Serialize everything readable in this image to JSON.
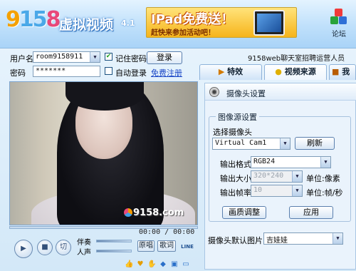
{
  "header": {
    "logo_digits": [
      "9",
      "15",
      "8"
    ],
    "app_title": "虚拟视频",
    "version": "4.1",
    "ad": {
      "headline": "IPad免费送！",
      "subline": "赶快来参加活动吧！"
    },
    "forum_label": "论坛"
  },
  "login": {
    "username_label": "用户名",
    "username_value": "room9158911",
    "password_label": "密码",
    "password_value": "*******",
    "remember_label": "记住密码",
    "remember_checked": true,
    "autologin_label": "自动登录",
    "autologin_checked": false,
    "login_button": "登录",
    "register_link": "免费注册"
  },
  "recruit_text": "9158web聊天室招聘运营人员",
  "tabs": [
    {
      "label": "特效",
      "icon": "play-icon"
    },
    {
      "label": "视频来源",
      "icon": "bulb-icon",
      "active": true
    },
    {
      "label": "我",
      "icon": "book-icon"
    }
  ],
  "video": {
    "watermark": "9158.com",
    "time_text": "00:00 / 00:00"
  },
  "player": {
    "accompany_label": "伴奏",
    "voice_label": "人声",
    "original_button": "原唱",
    "lyrics_button": "歌词",
    "line_label": "LINE",
    "cut_label": "切"
  },
  "settings": {
    "panel_title": "摄像头设置",
    "group_title": "图像源设置",
    "select_camera_label": "选择摄像头",
    "camera_value": "Virtual Cam1",
    "refresh_button": "刷新",
    "format_label": "输出格式",
    "format_value": "RGB24",
    "size_label": "输出大小",
    "size_value": "320*240",
    "size_unit": "单位:像素",
    "rate_label": "输出帧率",
    "rate_value": "10",
    "rate_unit": "单位:帧/秒",
    "adjust_button": "画质调整",
    "apply_button": "应用",
    "default_image_label": "摄像头默认图片",
    "default_image_value": "吉娃娃"
  }
}
